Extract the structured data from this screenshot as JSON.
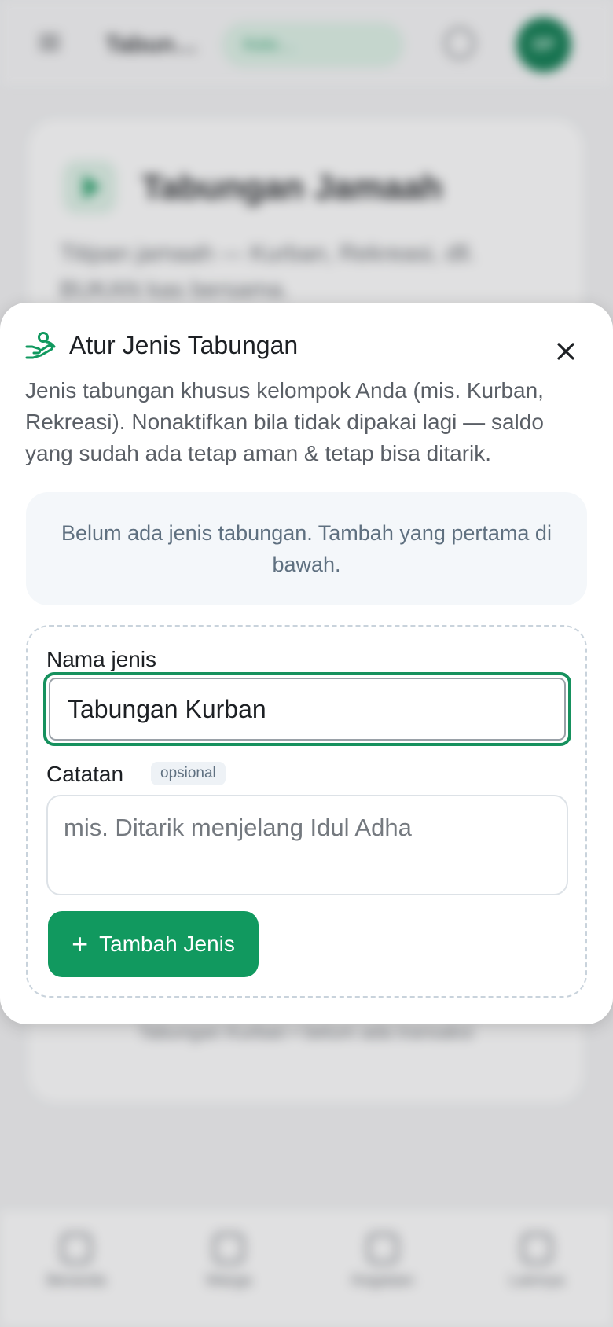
{
  "background": {
    "app_title": "Tabun…",
    "group_pill": "Kelo…",
    "avatar_initials": "DP",
    "hero_title": "Tabungan Jamaah",
    "hero_desc": "Titipan jamaah — Kurban, Rekreasi, dll. BUKAN kas bersama.",
    "hint": "Tabungan Kurban • belum ada transaksi",
    "nav": [
      {
        "label": "Beranda",
        "icon": "home-icon"
      },
      {
        "label": "Warga",
        "icon": "users-icon"
      },
      {
        "label": "Kegiatan",
        "icon": "calendar-icon"
      },
      {
        "label": "Lainnya",
        "icon": "grid-icon"
      }
    ]
  },
  "dialog": {
    "title": "Atur Jenis Tabungan",
    "icon": "hand-coins-icon",
    "close_icon": "close-icon",
    "description": "Jenis tabungan khusus kelompok Anda (mis. Kurban, Rekreasi). Nonaktifkan bila tidak dipakai lagi — saldo yang sudah ada tetap aman & tetap bisa ditarik.",
    "empty_state": "Belum ada jenis tabungan. Tambah yang pertama di bawah.",
    "form": {
      "name_label": "Nama jenis",
      "name_value": "Tabungan Kurban",
      "note_label": "Catatan",
      "note_badge": "opsional",
      "note_placeholder": "mis. Ditarik menjelang Idul Adha",
      "note_value": "",
      "submit_label": "Tambah Jenis",
      "submit_icon": "plus-icon"
    }
  },
  "colors": {
    "accent": "#11995f",
    "accent_focus_ring": "#16915e",
    "empty_box_bg": "#f4f7fa",
    "muted_text": "#5f7080"
  }
}
